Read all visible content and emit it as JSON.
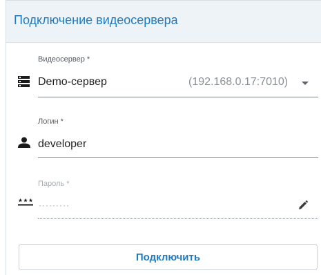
{
  "dialog": {
    "title": "Подключение видеосервера"
  },
  "server_field": {
    "label": "Видеосервер *",
    "value": "Demo-сервер",
    "address": "(192.168.0.17:7010)",
    "icon": "server-icon"
  },
  "login_field": {
    "label": "Логин *",
    "value": "developer",
    "icon": "person-icon"
  },
  "password_field": {
    "label": "Пароль *",
    "masked_value": "·········",
    "icon": "password-icon"
  },
  "connect_button": {
    "label": "Подключить"
  },
  "colors": {
    "accent": "#1f7ac2",
    "header_background": "#eef3f8"
  }
}
